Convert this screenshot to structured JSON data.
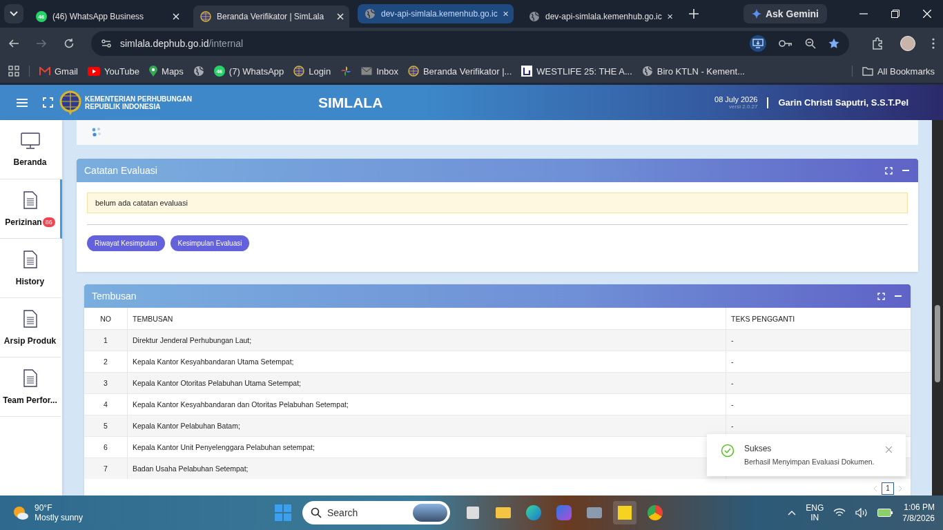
{
  "browser": {
    "tabs": [
      {
        "title": "(46) WhatsApp Business",
        "kind": "whatsapp",
        "badge": "46",
        "selected": false,
        "hovered": false
      },
      {
        "title": "Beranda Verifikator | SimLala",
        "kind": "emblem",
        "selected": true,
        "hovered": false
      },
      {
        "title": "dev-api-simlala.kemenhub.go.ic",
        "kind": "globe",
        "selected": false,
        "hovered": true
      },
      {
        "title": "dev-api-simlala.kemenhub.go.ic",
        "kind": "globe",
        "selected": false,
        "hovered": false
      }
    ],
    "ask_gemini": "Ask Gemini",
    "address_host": "simlala.dephub.go.id",
    "address_path": "/internal",
    "bookmarks": [
      {
        "label": "Gmail",
        "kind": "gmail"
      },
      {
        "label": "YouTube",
        "kind": "youtube"
      },
      {
        "label": "Maps",
        "kind": "maps"
      },
      {
        "kind": "globe"
      },
      {
        "label": "(7) WhatsApp",
        "kind": "whatsapp",
        "badge": "46"
      },
      {
        "label": "Login",
        "kind": "emblem"
      },
      {
        "kind": "pinwheel"
      },
      {
        "label": "Inbox",
        "kind": "mail"
      },
      {
        "label": "Beranda Verifikator |...",
        "kind": "emblem"
      },
      {
        "label": "WESTLIFE 25: THE A...",
        "kind": "square"
      },
      {
        "label": "Biro KTLN - Kement...",
        "kind": "globe"
      }
    ],
    "all_bookmarks": "All Bookmarks"
  },
  "app": {
    "org_line1": "KEMENTERIAN PERHUBUNGAN",
    "org_line2": "REPUBLIK INDONESIA",
    "title": "SIMLALA",
    "date": "08 July 2026",
    "version": "versi 2.0.27",
    "user": "Garin Christi Saputri, S.S.T.Pel"
  },
  "sidebar": {
    "items": [
      {
        "label": "Beranda",
        "kind": "monitor",
        "selected": false
      },
      {
        "label": "Perizinan",
        "kind": "document",
        "badge": "86",
        "selected": true
      },
      {
        "label": "History",
        "kind": "document",
        "selected": false
      },
      {
        "label": "Arsip Produk",
        "kind": "document",
        "selected": false
      },
      {
        "label": "Team Perfor...",
        "kind": "document",
        "selected": false
      }
    ]
  },
  "catatan": {
    "title": "Catatan Evaluasi",
    "note": "belum ada catatan evaluasi",
    "buttons": [
      "Riwayat Kesimpulan",
      "Kesimpulan Evaluasi"
    ]
  },
  "tembusan": {
    "title": "Tembusan",
    "columns": [
      "NO",
      "TEMBUSAN",
      "TEKS PENGGANTI"
    ],
    "rows": [
      {
        "no": "1",
        "tembusan": "Direktur Jenderal Perhubungan Laut;",
        "teks": "-"
      },
      {
        "no": "2",
        "tembusan": "Kepala Kantor Kesyahbandaran Utama Setempat;",
        "teks": "-"
      },
      {
        "no": "3",
        "tembusan": "Kepala Kantor Otoritas Pelabuhan Utama Setempat;",
        "teks": "-"
      },
      {
        "no": "4",
        "tembusan": "Kepala Kantor Kesyahbandaran dan Otoritas Pelabuhan Setempat;",
        "teks": "-"
      },
      {
        "no": "5",
        "tembusan": "Kepala Kantor Pelabuhan Batam;",
        "teks": "-"
      },
      {
        "no": "6",
        "tembusan": "Kepala Kantor Unit Penyelenggara Pelabuhan setempat;"
      },
      {
        "no": "7",
        "tembusan": "Badan Usaha Pelabuhan Setempat;"
      }
    ],
    "pages": [
      {
        "label": "1",
        "selected": true
      }
    ]
  },
  "toast": {
    "title": "Sukses",
    "message": "Berhasil Menyimpan Evaluasi Dokumen."
  },
  "taskbar": {
    "temperature": "90°F",
    "weather": "Mostly sunny",
    "search_placeholder": "Search",
    "lang1": "ENG",
    "lang2": "IN",
    "time": "1:06 PM",
    "date": "7/8/2026"
  }
}
